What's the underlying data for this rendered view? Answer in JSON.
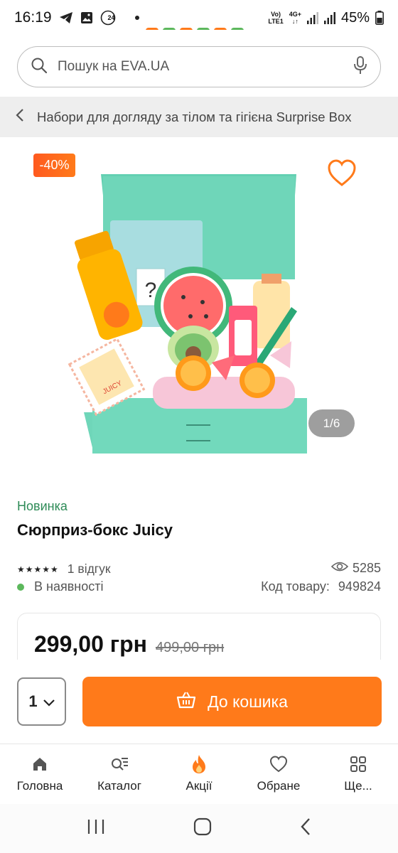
{
  "status_bar": {
    "time": "16:19",
    "notification_badge": "24",
    "network_top": "Vo)",
    "network_bottom": "LTE1",
    "network_type": "4G+",
    "battery": "45%"
  },
  "search": {
    "placeholder": "Пошук на EVA.UA",
    "icons": [
      "search-icon",
      "microphone-icon"
    ]
  },
  "breadcrumb": {
    "text": "Набори для догляду за тілом та гігієна Surprise Box"
  },
  "product": {
    "discount": "-40%",
    "gallery_counter": "1/6",
    "new_label": "Новинка",
    "title": "Сюрприз-бокс Juicy",
    "stars": "★★★★★",
    "rating": 5,
    "reviews": "1 відгук",
    "views": "5285",
    "stock": "В наявності",
    "code_label": "Код товару:",
    "code": "949824",
    "price": "299,00 грн",
    "old_price": "499,00 грн"
  },
  "buy": {
    "quantity": "1",
    "cart_label": "До кошика"
  },
  "bottom_nav": {
    "items": [
      {
        "label": "Головна",
        "icon": "home-icon"
      },
      {
        "label": "Каталог",
        "icon": "catalog-icon"
      },
      {
        "label": "Акції",
        "icon": "flame-icon"
      },
      {
        "label": "Обране",
        "icon": "heart-icon"
      },
      {
        "label": "Ще...",
        "icon": "grid-icon"
      }
    ]
  },
  "colors": {
    "accent": "#ff7a1a",
    "discount": "#ff5a1f",
    "new_label": "#2e8b57",
    "in_stock": "#5cb85c",
    "box_mint": "#6fd6b9"
  }
}
